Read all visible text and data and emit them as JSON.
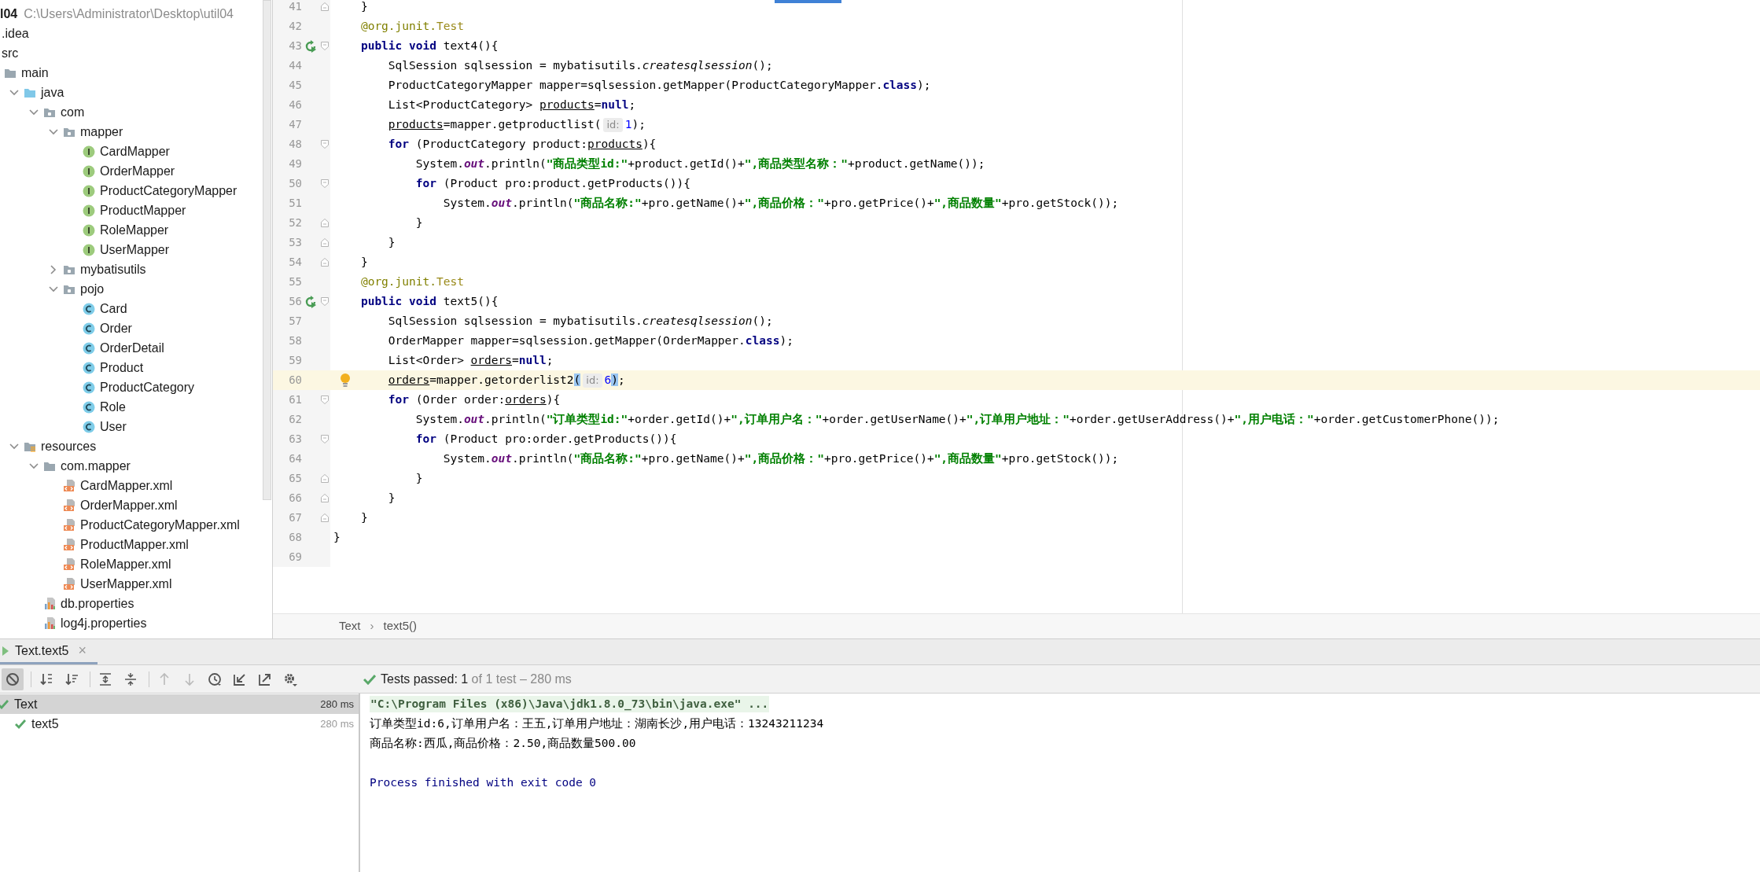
{
  "project_root": {
    "name": "l04",
    "path": "C:\\Users\\Administrator\\Desktop\\util04"
  },
  "project_tree": [
    {
      "name": ".idea"
    },
    {
      "name": "src",
      "children": [
        {
          "name": "main",
          "kind": "folder",
          "children": [
            {
              "name": "java",
              "kind": "source_folder",
              "expanded": true,
              "children": [
                {
                  "name": "com",
                  "kind": "package",
                  "expanded": true,
                  "children": [
                    {
                      "name": "mapper",
                      "kind": "package",
                      "expanded": true,
                      "children": [
                        {
                          "name": "CardMapper",
                          "kind": "interface"
                        },
                        {
                          "name": "OrderMapper",
                          "kind": "interface"
                        },
                        {
                          "name": "ProductCategoryMapper",
                          "kind": "interface"
                        },
                        {
                          "name": "ProductMapper",
                          "kind": "interface"
                        },
                        {
                          "name": "RoleMapper",
                          "kind": "interface"
                        },
                        {
                          "name": "UserMapper",
                          "kind": "interface"
                        }
                      ]
                    },
                    {
                      "name": "mybatisutils",
                      "kind": "package",
                      "expanded": false
                    },
                    {
                      "name": "pojo",
                      "kind": "package",
                      "expanded": true,
                      "children": [
                        {
                          "name": "Card",
                          "kind": "class"
                        },
                        {
                          "name": "Order",
                          "kind": "class"
                        },
                        {
                          "name": "OrderDetail",
                          "kind": "class"
                        },
                        {
                          "name": "Product",
                          "kind": "class"
                        },
                        {
                          "name": "ProductCategory",
                          "kind": "class"
                        },
                        {
                          "name": "Role",
                          "kind": "class"
                        },
                        {
                          "name": "User",
                          "kind": "class"
                        }
                      ]
                    }
                  ]
                }
              ]
            },
            {
              "name": "resources",
              "kind": "resources_folder",
              "expanded": true,
              "children": [
                {
                  "name": "com.mapper",
                  "kind": "folder",
                  "expanded": true,
                  "children": [
                    {
                      "name": "CardMapper.xml",
                      "kind": "xml"
                    },
                    {
                      "name": "OrderMapper.xml",
                      "kind": "xml"
                    },
                    {
                      "name": "ProductCategoryMapper.xml",
                      "kind": "xml"
                    },
                    {
                      "name": "ProductMapper.xml",
                      "kind": "xml"
                    },
                    {
                      "name": "RoleMapper.xml",
                      "kind": "xml"
                    },
                    {
                      "name": "UserMapper.xml",
                      "kind": "xml"
                    }
                  ]
                },
                {
                  "name": "db.properties",
                  "kind": "properties"
                },
                {
                  "name": "log4j.properties",
                  "kind": "properties"
                }
              ]
            }
          ]
        }
      ]
    }
  ],
  "editor": {
    "lines": [
      {
        "number": "41",
        "current": false,
        "gutter": [
          {
            "kind": "fold_end"
          }
        ],
        "code": [
          {
            "text": "    }",
            "kind": "plain"
          }
        ]
      },
      {
        "number": "42",
        "current": false,
        "code": [
          {
            "text": "    @org.junit.",
            "kind": "annotation"
          },
          {
            "text": "Test",
            "kind": "annotation_name"
          }
        ]
      },
      {
        "number": "43",
        "current": false,
        "gutter": [
          {
            "kind": "run"
          },
          {
            "kind": "fold_start"
          }
        ],
        "code": [
          {
            "text": "    public void",
            "kind": "keyword"
          },
          {
            "text": " text4(){",
            "kind": "plain"
          }
        ]
      },
      {
        "number": "44",
        "current": false,
        "code": [
          {
            "text": "        SqlSession sqlsession = mybatisutils.",
            "kind": "plain"
          },
          {
            "text": "createsqlsession",
            "kind": "italic"
          },
          {
            "text": "();",
            "kind": "plain"
          }
        ]
      },
      {
        "number": "45",
        "current": false,
        "code": [
          {
            "text": "        ProductCategoryMapper mapper=sqlsession.getMapper(ProductCategoryMapper.",
            "kind": "plain"
          },
          {
            "text": "class",
            "kind": "keyword"
          },
          {
            "text": ");",
            "kind": "plain"
          }
        ]
      },
      {
        "number": "46",
        "current": false,
        "code": [
          {
            "text": "        List<ProductCategory> ",
            "kind": "plain"
          },
          {
            "text": "products",
            "kind": "reassigned"
          },
          {
            "text": "=",
            "kind": "plain"
          },
          {
            "text": "null",
            "kind": "keyword"
          },
          {
            "text": ";",
            "kind": "plain"
          }
        ]
      },
      {
        "number": "47",
        "current": false,
        "code": [
          {
            "text": "        products",
            "kind": "reassigned"
          },
          {
            "text": "=mapper.getproductlist(",
            "kind": "plain"
          },
          {
            "text": "id:",
            "kind": "hint"
          },
          {
            "text": "1",
            "kind": "number"
          },
          {
            "text": ");",
            "kind": "plain"
          }
        ]
      },
      {
        "number": "48",
        "current": false,
        "gutter": [
          {
            "kind": "fold_start"
          }
        ],
        "code": [
          {
            "text": "        for",
            "kind": "keyword"
          },
          {
            "text": " (ProductCategory product:",
            "kind": "plain"
          },
          {
            "text": "products",
            "kind": "reassigned"
          },
          {
            "text": "){",
            "kind": "plain"
          }
        ]
      },
      {
        "number": "49",
        "current": false,
        "code": [
          {
            "text": "            System.",
            "kind": "plain"
          },
          {
            "text": "out",
            "kind": "static"
          },
          {
            "text": ".println(",
            "kind": "plain"
          },
          {
            "text": "\"商品类型id:\"",
            "kind": "string"
          },
          {
            "text": "+product.getId()+",
            "kind": "plain"
          },
          {
            "text": "\",商品类型名称：\"",
            "kind": "string"
          },
          {
            "text": "+product.getName());",
            "kind": "plain"
          }
        ]
      },
      {
        "number": "50",
        "current": false,
        "gutter": [
          {
            "kind": "fold_start"
          }
        ],
        "code": [
          {
            "text": "            for",
            "kind": "keyword"
          },
          {
            "text": " (Product pro:product.getProducts()){",
            "kind": "plain"
          }
        ]
      },
      {
        "number": "51",
        "current": false,
        "code": [
          {
            "text": "                System.",
            "kind": "plain"
          },
          {
            "text": "out",
            "kind": "static"
          },
          {
            "text": ".println(",
            "kind": "plain"
          },
          {
            "text": "\"商品名称:\"",
            "kind": "string"
          },
          {
            "text": "+pro.getName()+",
            "kind": "plain"
          },
          {
            "text": "\",商品价格：\"",
            "kind": "string"
          },
          {
            "text": "+pro.getPrice()+",
            "kind": "plain"
          },
          {
            "text": "\",商品数量\"",
            "kind": "string"
          },
          {
            "text": "+pro.getStock());",
            "kind": "plain"
          }
        ]
      },
      {
        "number": "52",
        "current": false,
        "gutter": [
          {
            "kind": "fold_end"
          }
        ],
        "code": [
          {
            "text": "            }",
            "kind": "plain"
          }
        ]
      },
      {
        "number": "53",
        "current": false,
        "gutter": [
          {
            "kind": "fold_end"
          }
        ],
        "code": [
          {
            "text": "        }",
            "kind": "plain"
          }
        ]
      },
      {
        "number": "54",
        "current": false,
        "gutter": [
          {
            "kind": "fold_end"
          }
        ],
        "code": [
          {
            "text": "    }",
            "kind": "plain"
          }
        ]
      },
      {
        "number": "55",
        "current": false,
        "code": [
          {
            "text": "    @org.junit.",
            "kind": "annotation"
          },
          {
            "text": "Test",
            "kind": "annotation_name"
          }
        ]
      },
      {
        "number": "56",
        "current": false,
        "gutter": [
          {
            "kind": "run"
          },
          {
            "kind": "fold_start"
          }
        ],
        "code": [
          {
            "text": "    public void",
            "kind": "keyword"
          },
          {
            "text": " text5(){",
            "kind": "plain"
          }
        ]
      },
      {
        "number": "57",
        "current": false,
        "code": [
          {
            "text": "        SqlSession sqlsession = mybatisutils.",
            "kind": "plain"
          },
          {
            "text": "createsqlsession",
            "kind": "italic"
          },
          {
            "text": "();",
            "kind": "plain"
          }
        ]
      },
      {
        "number": "58",
        "current": false,
        "code": [
          {
            "text": "        OrderMapper mapper=sqlsession.getMapper(OrderMapper.",
            "kind": "plain"
          },
          {
            "text": "class",
            "kind": "keyword"
          },
          {
            "text": ");",
            "kind": "plain"
          }
        ]
      },
      {
        "number": "59",
        "current": false,
        "code": [
          {
            "text": "        List<Order> ",
            "kind": "plain"
          },
          {
            "text": "orders",
            "kind": "reassigned"
          },
          {
            "text": "=",
            "kind": "plain"
          },
          {
            "text": "null",
            "kind": "keyword"
          },
          {
            "text": ";",
            "kind": "plain"
          }
        ]
      },
      {
        "number": "60",
        "current": true,
        "gutter": [
          {
            "kind": "bulb"
          }
        ],
        "code": [
          {
            "text": "        orders",
            "kind": "reassigned"
          },
          {
            "text": "=mapper.getorderlist2",
            "kind": "plain"
          },
          {
            "text": "(",
            "kind": "brace_match"
          },
          {
            "text": "id:",
            "kind": "hint"
          },
          {
            "text": "6",
            "kind": "number"
          },
          {
            "text": ")",
            "kind": "brace_match"
          },
          {
            "text": ";",
            "kind": "plain"
          }
        ]
      },
      {
        "number": "61",
        "current": false,
        "gutter": [
          {
            "kind": "fold_start"
          }
        ],
        "code": [
          {
            "text": "        for",
            "kind": "keyword"
          },
          {
            "text": " (Order order:",
            "kind": "plain"
          },
          {
            "text": "orders",
            "kind": "reassigned"
          },
          {
            "text": "){",
            "kind": "plain"
          }
        ]
      },
      {
        "number": "62",
        "current": false,
        "code": [
          {
            "text": "            System.",
            "kind": "plain"
          },
          {
            "text": "out",
            "kind": "static"
          },
          {
            "text": ".println(",
            "kind": "plain"
          },
          {
            "text": "\"订单类型id:\"",
            "kind": "string"
          },
          {
            "text": "+order.getId()+",
            "kind": "plain"
          },
          {
            "text": "\",订单用户名：\"",
            "kind": "string"
          },
          {
            "text": "+order.getUserName()+",
            "kind": "plain"
          },
          {
            "text": "\",订单用户地址：\"",
            "kind": "string"
          },
          {
            "text": "+order.getUserAddress()+",
            "kind": "plain"
          },
          {
            "text": "\",用户电话：\"",
            "kind": "string"
          },
          {
            "text": "+order.getCustomerPhone());",
            "kind": "plain"
          }
        ]
      },
      {
        "number": "63",
        "current": false,
        "gutter": [
          {
            "kind": "fold_start"
          }
        ],
        "code": [
          {
            "text": "            for",
            "kind": "keyword"
          },
          {
            "text": " (Product pro:order.getProducts()){",
            "kind": "plain"
          }
        ]
      },
      {
        "number": "64",
        "current": false,
        "code": [
          {
            "text": "                System.",
            "kind": "plain"
          },
          {
            "text": "out",
            "kind": "static"
          },
          {
            "text": ".println(",
            "kind": "plain"
          },
          {
            "text": "\"商品名称:\"",
            "kind": "string"
          },
          {
            "text": "+pro.getName()+",
            "kind": "plain"
          },
          {
            "text": "\",商品价格：\"",
            "kind": "string"
          },
          {
            "text": "+pro.getPrice()+",
            "kind": "plain"
          },
          {
            "text": "\",商品数量\"",
            "kind": "string"
          },
          {
            "text": "+pro.getStock());",
            "kind": "plain"
          }
        ]
      },
      {
        "number": "65",
        "current": false,
        "gutter": [
          {
            "kind": "fold_end"
          }
        ],
        "code": [
          {
            "text": "            }",
            "kind": "plain"
          }
        ]
      },
      {
        "number": "66",
        "current": false,
        "gutter": [
          {
            "kind": "fold_end"
          }
        ],
        "code": [
          {
            "text": "        }",
            "kind": "plain"
          }
        ]
      },
      {
        "number": "67",
        "current": false,
        "gutter": [
          {
            "kind": "fold_end"
          }
        ],
        "code": [
          {
            "text": "    }",
            "kind": "plain"
          }
        ]
      },
      {
        "number": "68",
        "current": false,
        "code": [
          {
            "text": "}",
            "kind": "plain"
          }
        ]
      },
      {
        "number": "69",
        "current": false
      }
    ]
  },
  "breadcrumbs": {
    "items": [
      "Text",
      "text5()"
    ],
    "separator": "›"
  },
  "run_tab": {
    "label": "Text.text5",
    "close": "×"
  },
  "toolbar": [
    {
      "kind": "filter",
      "on": true,
      "disabled": false
    },
    {
      "kind": "sort_alpha",
      "on": false,
      "disabled": false
    },
    {
      "kind": "sort_duration",
      "on": false,
      "disabled": false
    },
    {
      "kind": "expand_all",
      "on": false,
      "disabled": false
    },
    {
      "kind": "collapse_all",
      "on": false,
      "disabled": false
    },
    {
      "kind": "up",
      "on": false,
      "disabled": true
    },
    {
      "kind": "down",
      "on": false,
      "disabled": true
    },
    {
      "kind": "history",
      "on": false,
      "disabled": false
    },
    {
      "kind": "import",
      "on": false,
      "disabled": false
    },
    {
      "kind": "export",
      "on": false,
      "disabled": false
    },
    {
      "kind": "settings",
      "on": false,
      "disabled": false
    }
  ],
  "test_status": {
    "label": "Tests passed:",
    "count": "1",
    "detail": "of 1 test – 280 ms"
  },
  "test_tree": [
    {
      "name": "Text",
      "duration": "280 ms",
      "selected": true,
      "children": [
        {
          "name": "text5",
          "duration": "280 ms",
          "selected": false
        }
      ]
    }
  ],
  "console": [
    {
      "kind": "command",
      "text": "\"C:\\Program Files (x86)\\Java\\jdk1.8.0_73\\bin\\java.exe\" ..."
    },
    {
      "kind": "stdout",
      "text": "订单类型id:6,订单用户名：王五,订单用户地址：湖南长沙,用户电话：13243211234"
    },
    {
      "kind": "stdout",
      "text": "商品名称:西瓜,商品价格：2.50,商品数量500.00"
    },
    {
      "kind": "system",
      "text": "Process finished with exit code 0"
    }
  ]
}
